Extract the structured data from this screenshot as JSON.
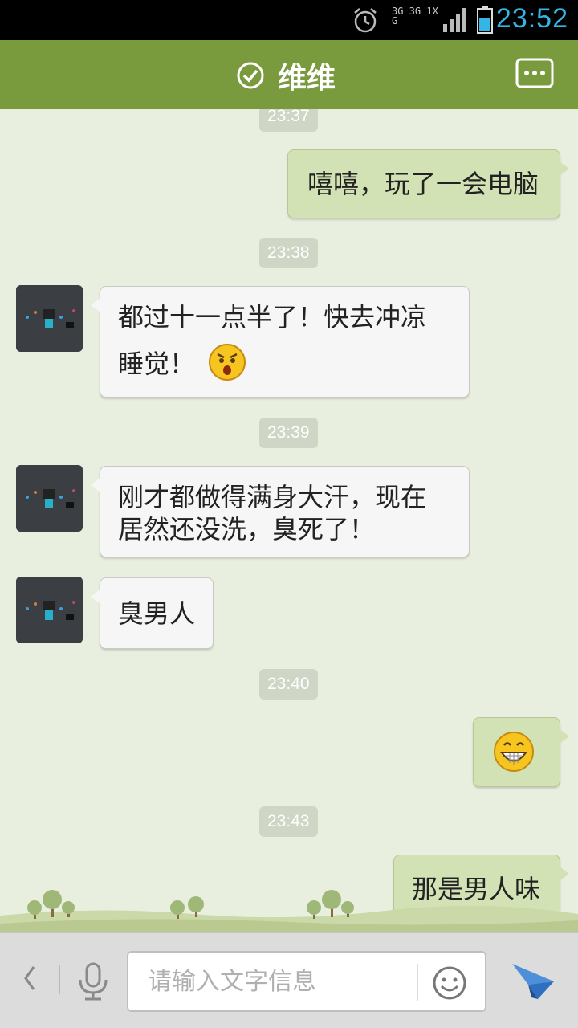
{
  "status_bar": {
    "time": "23:52",
    "network_label": "3G 3G 1X G",
    "time_color": "#33b5e5"
  },
  "header": {
    "title": "维维",
    "verified_icon": "check-circle-icon",
    "more_icon": "chat-dots-icon",
    "bg_color": "#7a9a3e"
  },
  "messages": [
    {
      "type": "timestamp",
      "text": "23:37"
    },
    {
      "type": "outgoing",
      "text": "嘻嘻，玩了一会电脑"
    },
    {
      "type": "timestamp",
      "text": "23:38"
    },
    {
      "type": "incoming",
      "lines": [
        "都过十一点半了！快去冲凉",
        "睡觉！"
      ],
      "emoji": "surprised-face-emoji"
    },
    {
      "type": "timestamp",
      "text": "23:39"
    },
    {
      "type": "incoming",
      "lines": [
        "刚才都做得满身大汗，现在",
        "居然还没洗，臭死了！"
      ]
    },
    {
      "type": "incoming",
      "lines": [
        "臭男人"
      ]
    },
    {
      "type": "timestamp",
      "text": "23:40"
    },
    {
      "type": "outgoing",
      "emoji": "grinning-face-emoji"
    },
    {
      "type": "timestamp",
      "text": "23:43"
    },
    {
      "type": "outgoing",
      "text": "那是男人味"
    }
  ],
  "input_bar": {
    "placeholder": "请输入文字信息",
    "back_icon": "chevron-left-icon",
    "mic_icon": "microphone-icon",
    "emoji_icon": "smiley-icon",
    "send_icon": "paper-plane-icon"
  }
}
